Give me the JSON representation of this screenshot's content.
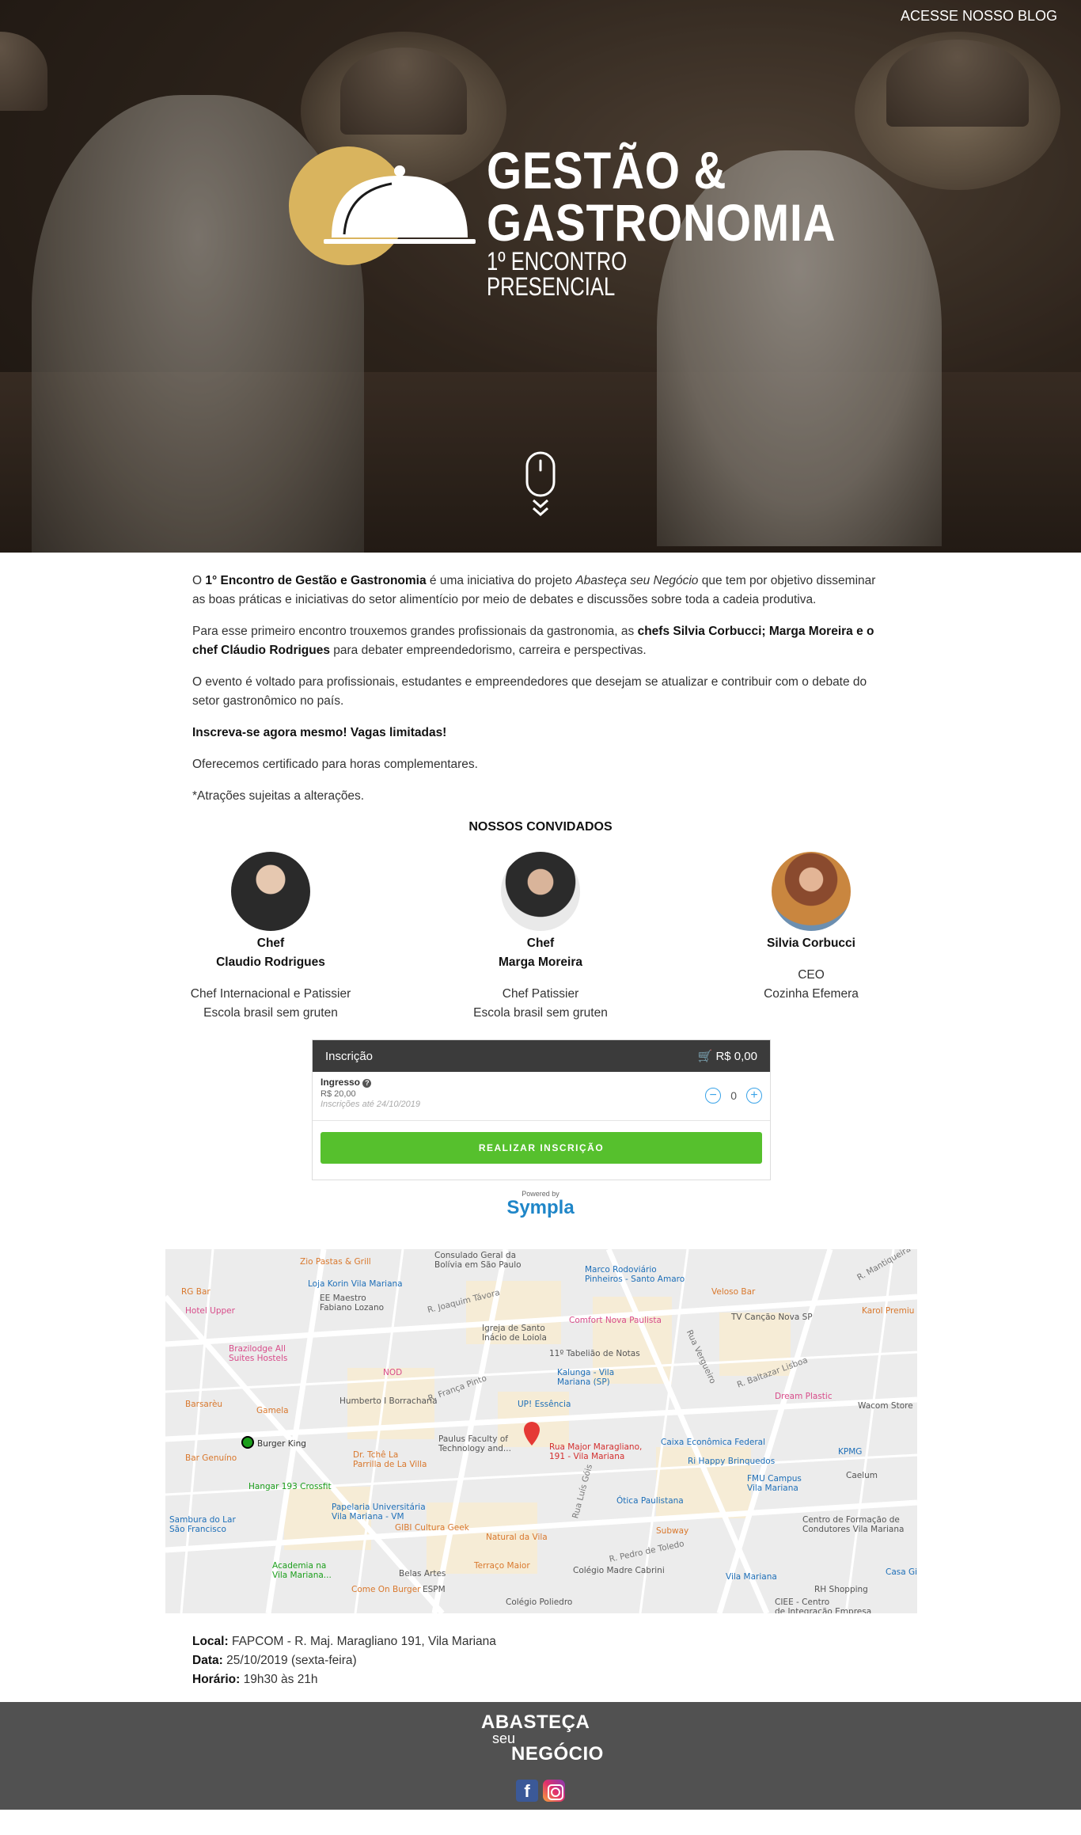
{
  "header": {
    "blog_link": "ACESSE NOSSO BLOG",
    "logo_line1": "GESTÃO &",
    "logo_line2": "GASTRONOMIA",
    "logo_line3": "1º ENCONTRO PRESENCIAL",
    "accent_color": "#d9b45e"
  },
  "intro": {
    "p1_a": "O ",
    "p1_b": "1° Encontro de Gestão e Gastronomia",
    "p1_c": " é uma iniciativa do projeto ",
    "p1_d": "Abasteça seu Negócio",
    "p1_e": " que tem por objetivo disseminar as boas práticas e iniciativas do setor alimentício por meio de debates e discussões sobre toda a cadeia produtiva.",
    "p2_a": "Para esse primeiro encontro trouxemos grandes profissionais da gastronomia, as ",
    "p2_b": "chefs Silvia Corbucci; Marga Moreira e o chef Cláudio Rodrigues",
    "p2_c": " para debater empreendedorismo, carreira e perspectivas.",
    "p3": "O evento é voltado para profissionais, estudantes e empreendedores que desejam se atualizar e contribuir com o debate do setor gastronômico no país.",
    "p4": "Inscreva-se agora mesmo! Vagas limitadas!",
    "p5": "Oferecemos certificado para horas complementares.",
    "p6": "*Atrações sujeitas a alterações."
  },
  "guests": {
    "title": "NOSSOS CONVIDADOS",
    "items": [
      {
        "name1": "Chef",
        "name2": "Claudio Rodrigues",
        "role1": "Chef Internacional e Patissier",
        "role2": "Escola brasil sem gruten"
      },
      {
        "name1": "Chef",
        "name2": "Marga Moreira",
        "role1": "Chef Patissier",
        "role2": "Escola brasil sem gruten"
      },
      {
        "name1": "Silvia Corbucci",
        "name2": "",
        "role1": "CEO",
        "role2": "Cozinha Efemera"
      }
    ]
  },
  "widget": {
    "title": "Inscrição",
    "cart_total": "R$ 0,00",
    "ticket_name": "Ingresso",
    "ticket_price": "R$ 20,00",
    "ticket_deadline": "Inscrições até 24/10/2019",
    "quantity": "0",
    "cta": "REALIZAR INSCRIÇÃO",
    "cta_color": "#56c02d",
    "powered_by": "Powered by",
    "brand": "Sympla"
  },
  "map": {
    "labels": [
      "Zio Pastas & Grill",
      "Consulado Geral da",
      "Bolívia em São Paulo",
      "Marco Rodoviário",
      "Pinheiros - Santo Amaro",
      "RG Bar",
      "Loja Korin Vila Mariana",
      "EE Maestro",
      "Fabiano Lozano",
      "Veloso Bar",
      "Hotel Upper",
      "Igreja de Santo",
      "Inácio de Loiola",
      "Comfort Nova Paulista",
      "TV Canção Nova SP",
      "Karol Premiu",
      "Brazilodge All",
      "Suites Hostels",
      "11º Tabelião de Notas",
      "Kalunga - Vila",
      "Mariana (SP)",
      "NOD",
      "Humberto I Borracharia",
      "UP! Essência",
      "Dream Plastic",
      "Wacom Store",
      "Barsarèu",
      "Gamela",
      "Paulus Faculty of",
      "Technology and...",
      "Rua Major Maragliano,",
      "191 - Vila Mariana",
      "Caixa Econômica Federal",
      "Burger King",
      "Dr. Tchê La",
      "Parrilla de La Villa",
      "Ri Happy Brinquedos",
      "KPMG",
      "Bar Genuíno",
      "Hangar 193 Crossfit",
      "FMU Campus",
      "Vila Mariana",
      "Caelum",
      "Papelaria Universitária",
      "Vila Mariana - VM",
      "Ótica Paulistana",
      "Sambura do Lar",
      "São Francisco",
      "GIBI Cultura Geek",
      "Natural da Vila",
      "Subway",
      "Centro de Formação de",
      "Condutores Vila Mariana",
      "Academia na",
      "Vila Mariana...",
      "Belas Artes",
      "Terraço Maior",
      "Colégio Madre Cabrini",
      "Vila Mariana",
      "Casa Gi",
      "Come On Burger",
      "ESPM",
      "RH Shopping",
      "CIEE - Centro",
      "de Integração Empresa",
      "Colégio Poliedro",
      "R. Joaquim Távora",
      "R. França Pinto",
      "Rua Vergueiro",
      "R. Baltazar Lisboa",
      "R. Mantiqueira",
      "Rua Luís Góis",
      "R. Pedro de Toledo"
    ]
  },
  "info": {
    "local_label": "Local:",
    "local_value": " FAPCOM - R. Maj. Maragliano 191, Vila Mariana",
    "data_label": "Data:",
    "data_value": " 25/10/2019 (sexta-feira)",
    "horario_label": "Horário:",
    "horario_value": " 19h30 às 21h"
  },
  "footer": {
    "logo_line1": "ABASTEÇA",
    "logo_line2": "seu",
    "logo_line3": "NEGÓCIO",
    "fb_letter": "f",
    "icons": [
      "facebook-icon",
      "instagram-icon"
    ]
  }
}
